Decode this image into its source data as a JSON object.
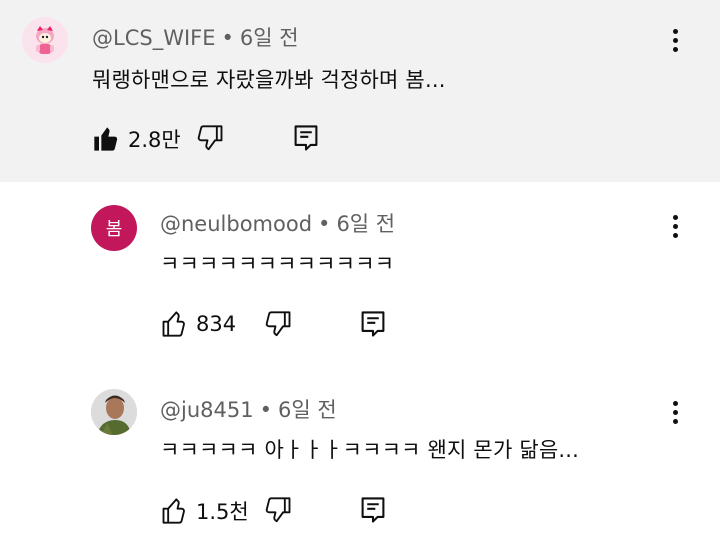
{
  "comments": [
    {
      "handle": "@LCS_WIFE",
      "age": "6일 전",
      "text": "뭐랭하맨으로 자랐을까봐 걱정하며 봄...",
      "likes": "2.8만",
      "liked": true,
      "avatar_icon": "cartoon-character-avatar"
    },
    {
      "handle": "@neulbomood",
      "age": "6일 전",
      "text": "ㅋㅋㅋㅋㅋㅋㅋㅋㅋㅋㅋㅋ",
      "likes": "834",
      "liked": false,
      "avatar_letter": "봄",
      "avatar_color": "#c2185b"
    },
    {
      "handle": "@ju8451",
      "age": "6일 전",
      "text": "ㅋㅋㅋㅋㅋ 아ㅏㅏㅏㅋㅋㅋㅋ 왠지 몬가 닮음...",
      "likes": "1.5천",
      "liked": false,
      "avatar_icon": "photo-avatar"
    }
  ],
  "separator": "•"
}
